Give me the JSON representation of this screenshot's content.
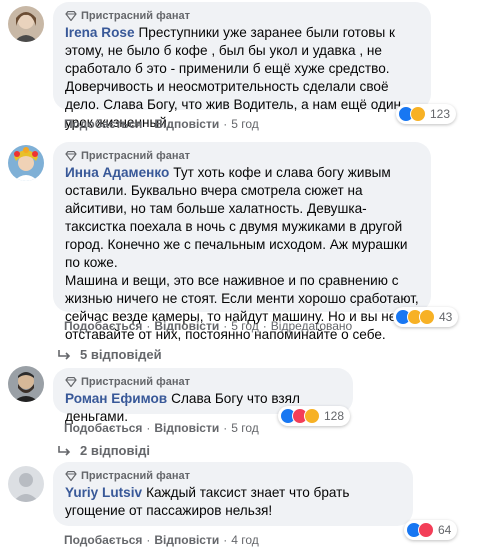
{
  "comments": [
    {
      "badge": "Пристрасний фанат",
      "author": "Irena Rose",
      "text": "Преступники уже заранее были готовы к этому, не было б кофе , был бы укол и удавка , не сработало б это - применили б ещё хуже средство. Доверчивость и неосмотрительность сделали своё дело. Слава Богу, что жив Водитель, а нам ещё один урок жизненный.",
      "reaction_count": "123",
      "like": "Подобається",
      "reply": "Відповісти",
      "time": "5 год"
    },
    {
      "badge": "Пристрасний фанат",
      "author": "Инна Адаменко",
      "text": "Тут хоть кофе и слава богу живым оставили. Буквально вчера смотрела сюжет на айситиви, но там больше халатность. Девушка-таксистка поехала в ночь с двумя мужиками в другой город. Конечно же с печальным исходом. Аж мурашки по коже.\nМашина и вещи, это все наживное и по сравнению с жизнью ничего не стоят. Если менти хорошо сработают, сейчас везде камеры, то найдут машину. Но и вы не отставайте от них, постоянно напоминайте о себе.",
      "reaction_count": "43",
      "like": "Подобається",
      "reply": "Відповісти",
      "time": "5 год",
      "edited": "Відредаговано"
    },
    {
      "badge": "Пристрасний фанат",
      "author": "Роман Ефимов",
      "text": "Слава Богу что взял деньгами.",
      "reaction_count": "128",
      "like": "Подобається",
      "reply": "Відповісти",
      "time": "5 год"
    },
    {
      "badge": "Пристрасний фанат",
      "author": "Yuriy Lutsiv",
      "text": "Каждый таксист знает что брать угощение от пассажиров нельзя!",
      "reaction_count": "64",
      "like": "Подобається",
      "reply": "Відповісти",
      "time": "4 год"
    }
  ],
  "replies": [
    {
      "label": "5 відповідей"
    },
    {
      "label": "2 відповіді"
    }
  ],
  "colors": {
    "bubble": "#f0f2f5",
    "author": "#385898",
    "muted": "#65676b",
    "like": "#1877f2",
    "love": "#f33e58",
    "sad": "#f7b125"
  }
}
